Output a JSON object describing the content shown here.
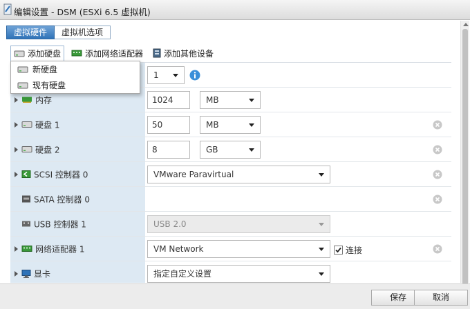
{
  "window": {
    "title": "编辑设置 - DSM (ESXi 6.5 虚拟机)"
  },
  "tabs": [
    {
      "label": "虚拟硬件",
      "active": true
    },
    {
      "label": "虚拟机选项",
      "active": false
    }
  ],
  "toolbar": {
    "add_disk": "添加硬盘",
    "add_network": "添加网络适配器",
    "add_other": "添加其他设备"
  },
  "dropdown": {
    "items": [
      {
        "label": "新硬盘",
        "icon": "disk-icon"
      },
      {
        "label": "现有硬盘",
        "icon": "disk-icon"
      }
    ]
  },
  "rows": {
    "cpu": {
      "value": "1"
    },
    "memory": {
      "label": "内存",
      "value": "1024",
      "unit": "MB"
    },
    "disk1": {
      "label": "硬盘 1",
      "value": "50",
      "unit": "MB"
    },
    "disk2": {
      "label": "硬盘 2",
      "value": "8",
      "unit": "GB"
    },
    "scsi": {
      "label": "SCSI 控制器 0",
      "value": "VMware Paravirtual"
    },
    "sata": {
      "label": "SATA 控制器 0"
    },
    "usb": {
      "label": "USB 控制器 1",
      "value": "USB 2.0"
    },
    "network": {
      "label": "网络适配器 1",
      "value": "VM Network",
      "connect_label": "连接",
      "connected": true
    },
    "video": {
      "label": "显卡",
      "value": "指定自定义设置"
    }
  },
  "footer": {
    "save": "保存",
    "cancel": "取消"
  },
  "colors": {
    "accent": "#2f73b8",
    "label_bg": "#dde9f3",
    "info": "#3b8fd9"
  }
}
